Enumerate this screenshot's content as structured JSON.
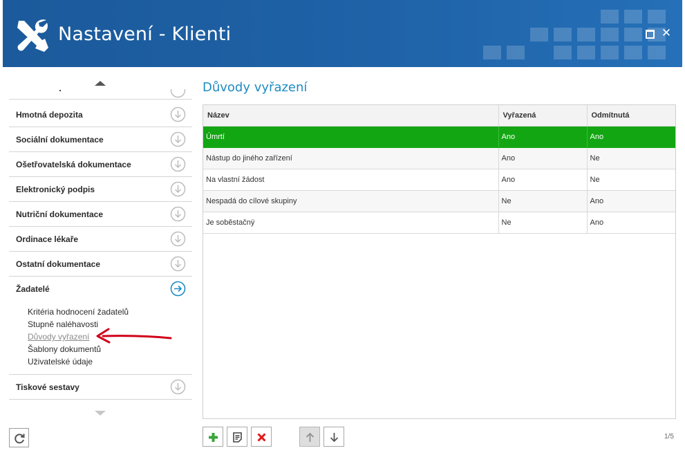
{
  "window": {
    "title": "Nastavení - Klienti",
    "app_icon": "wrench-screwdriver-icon",
    "colors": {
      "header": "#1f62a7",
      "accent": "#1e8bc3",
      "selected_row": "#13a613",
      "annotation_arrow": "#d0021b"
    }
  },
  "sidebar": {
    "items": [
      {
        "label": "Hmotná depozita",
        "icon": "circle-arrow-down-icon"
      },
      {
        "label": "Sociální dokumentace",
        "icon": "circle-arrow-down-icon"
      },
      {
        "label": "Ošetřovatelská dokumentace",
        "icon": "circle-arrow-down-icon"
      },
      {
        "label": "Elektronický podpis",
        "icon": "circle-arrow-down-icon"
      },
      {
        "label": "Nutriční dokumentace",
        "icon": "circle-arrow-down-icon"
      },
      {
        "label": "Ordinace lékaře",
        "icon": "circle-arrow-down-icon"
      },
      {
        "label": "Ostatní dokumentace",
        "icon": "circle-arrow-down-icon"
      },
      {
        "label": "Žadatelé",
        "icon": "circle-arrow-right-icon"
      },
      {
        "label": "Tiskové sestavy",
        "icon": "circle-arrow-down-icon"
      }
    ],
    "expanded": {
      "subitems": [
        "Kritéria hodnocení žadatelů",
        "Stupně naléhavosti",
        "Důvody vyřazení",
        "Šablony dokumentů",
        "Uživatelské údaje"
      ],
      "active": "Důvody vyřazení"
    }
  },
  "main": {
    "title": "Důvody vyřazení",
    "columns": [
      "Název",
      "Vyřazená",
      "Odmítnutá"
    ],
    "rows": [
      [
        "Úmrtí",
        "Ano",
        "Ano"
      ],
      [
        "Nástup do jiného zařízení",
        "Ano",
        "Ne"
      ],
      [
        "Na vlastní žádost",
        "Ano",
        "Ne"
      ],
      [
        "Nespadá do cílové skupiny",
        "Ne",
        "Ano"
      ],
      [
        "Je soběstačný",
        "Ne",
        "Ano"
      ]
    ],
    "selected_row": 0,
    "pager": "1/5"
  },
  "toolbar": {
    "buttons": [
      "plus-icon",
      "edit-icon",
      "delete-x-icon",
      "arrow-up-icon",
      "arrow-down-icon"
    ]
  }
}
